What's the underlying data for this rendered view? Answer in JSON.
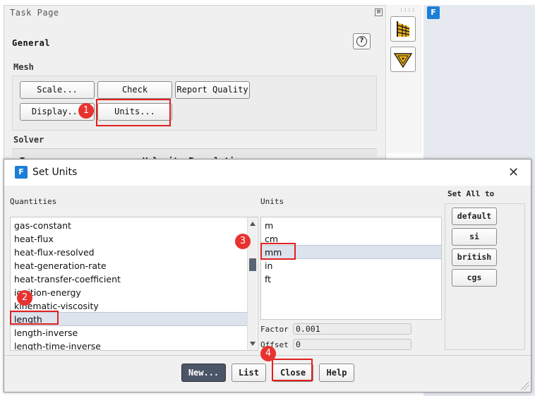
{
  "task_page": {
    "title": "Task Page",
    "close_glyph": "⊠",
    "general_title": "General",
    "help_glyph": "?",
    "mesh": {
      "title": "Mesh",
      "buttons": [
        "Scale...",
        "Check",
        "Report Quality",
        "Display...",
        "Units..."
      ]
    },
    "solver": {
      "title": "Solver",
      "type_label": "Type",
      "velocity_label": "Velocity Formulation"
    }
  },
  "toolbar": {
    "grip": "::::",
    "tools": [
      "mesh-tool-icon",
      "warning-triangle-icon"
    ]
  },
  "logo_letter": "F",
  "dialog": {
    "title": "Set Units",
    "close_glyph": "✕",
    "quantities_label": "Quantities",
    "quantities": [
      "gas-constant",
      "heat-flux",
      "heat-flux-resolved",
      "heat-generation-rate",
      "heat-transfer-coefficient",
      "ignition-energy",
      "kinematic-viscosity",
      "length",
      "length-inverse",
      "length-time-inverse"
    ],
    "selected_quantity": "length",
    "units_label": "Units",
    "units": [
      "m",
      "cm",
      "mm",
      "in",
      "ft"
    ],
    "selected_unit": "mm",
    "factor_label": "Factor",
    "factor_value": "0.001",
    "offset_label": "Offset",
    "offset_value": "0",
    "set_all_label": "Set All to",
    "set_all_buttons": [
      "default",
      "si",
      "british",
      "cgs"
    ],
    "footer_buttons": [
      "New...",
      "List",
      "Close",
      "Help"
    ]
  },
  "annotations": [
    "1",
    "2",
    "3",
    "4"
  ],
  "colors": {
    "accent": "#1c7fd6",
    "callout": "#e8322f",
    "highlight": "#e02020",
    "selection": "#dde3ec",
    "new_button": "#4a5568"
  }
}
